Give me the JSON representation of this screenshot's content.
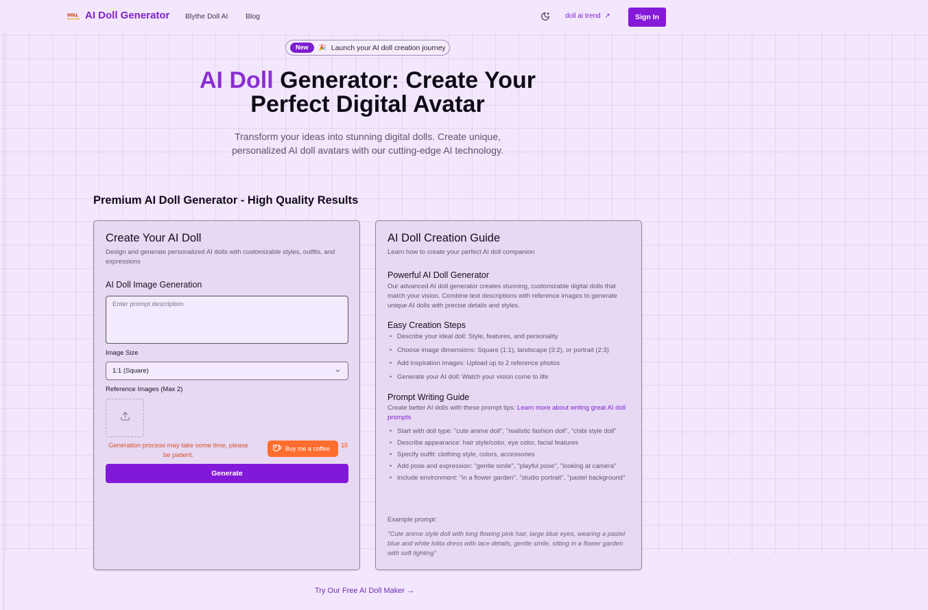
{
  "header": {
    "brand_logo_text": "DOLL",
    "brand_name": "AI Doll Generator",
    "nav_items": [
      "Blythe Doll AI",
      "Blog"
    ],
    "trend_link": "doll ai trend",
    "sign_in": "Sign In"
  },
  "hero": {
    "badge": "New",
    "badge_text": "Launch your AI doll creation journey",
    "title_accent": "AI Doll",
    "title_rest": " Generator: Create Your Perfect Digital Avatar",
    "subtitle": "Transform your ideas into stunning digital dolls. Create unique, personalized AI doll avatars with our cutting-edge AI technology."
  },
  "section_title": "Premium AI Doll Generator - High Quality Results",
  "create_card": {
    "title": "Create Your AI Doll",
    "description": "Design and generate personalized AI dolls with customizable styles, outfits, and expressions",
    "generation_label": "AI Doll Image Generation",
    "prompt_placeholder": "Enter prompt description",
    "size_label": "Image Size",
    "size_value": "1:1 (Square)",
    "ref_label": "Reference Images (Max 2)",
    "notice": "Generation process may take some time, please be patient.",
    "coffee_label": "Buy me a coffee",
    "coffee_count": "15",
    "generate": "Generate"
  },
  "guide_card": {
    "title": "AI Doll Creation Guide",
    "description": "Learn how to create your perfect AI doll companion",
    "powerful_title": "Powerful AI Doll Generator",
    "powerful_text": "Our advanced AI doll generator creates stunning, customizable digital dolls that match your vision. Combine text descriptions with reference images to generate unique AI dolls with precise details and styles.",
    "steps_title": "Easy Creation Steps",
    "steps": [
      "Describe your ideal doll: Style, features, and personality",
      "Choose image dimensions: Square (1:1), landscape (3:2), or portrait (2:3)",
      "Add inspiration images: Upload up to 2 reference photos",
      "Generate your AI doll: Watch your vision come to life"
    ],
    "prompt_title": "Prompt Writing Guide",
    "prompt_intro": "Create better AI dolls with these prompt tips: ",
    "prompt_link": "Learn more about writing great AI doll prompts",
    "tips": [
      "Start with doll type: \"cute anime doll\", \"realistic fashion doll\", \"chibi style doll\"",
      "Describe appearance: hair style/color, eye color, facial features",
      "Specify outfit: clothing style, colors, accessories",
      "Add pose and expression: \"gentle smile\", \"playful pose\", \"looking at camera\"",
      "Include environment: \"in a flower garden\", \"studio portrait\", \"pastel background\""
    ],
    "example_label": "Example prompt:",
    "example_text": "\"Cute anime style doll with long flowing pink hair, large blue eyes, wearing a pastel blue and white lolita dress with lace details, gentle smile, sitting in a flower garden with soft lighting\""
  },
  "footer": {
    "link": "Try Our Free AI Doll Maker →"
  },
  "colors": {
    "accent": "#8519d8",
    "brand": "#7e22ce",
    "background": "#f3e7fd",
    "coffee": "#ff6e2f"
  },
  "icons": [
    "moon-icon",
    "external-arrow-icon",
    "sparkle-icon",
    "chevron-down-icon",
    "upload-icon",
    "coffee-cup-icon"
  ]
}
